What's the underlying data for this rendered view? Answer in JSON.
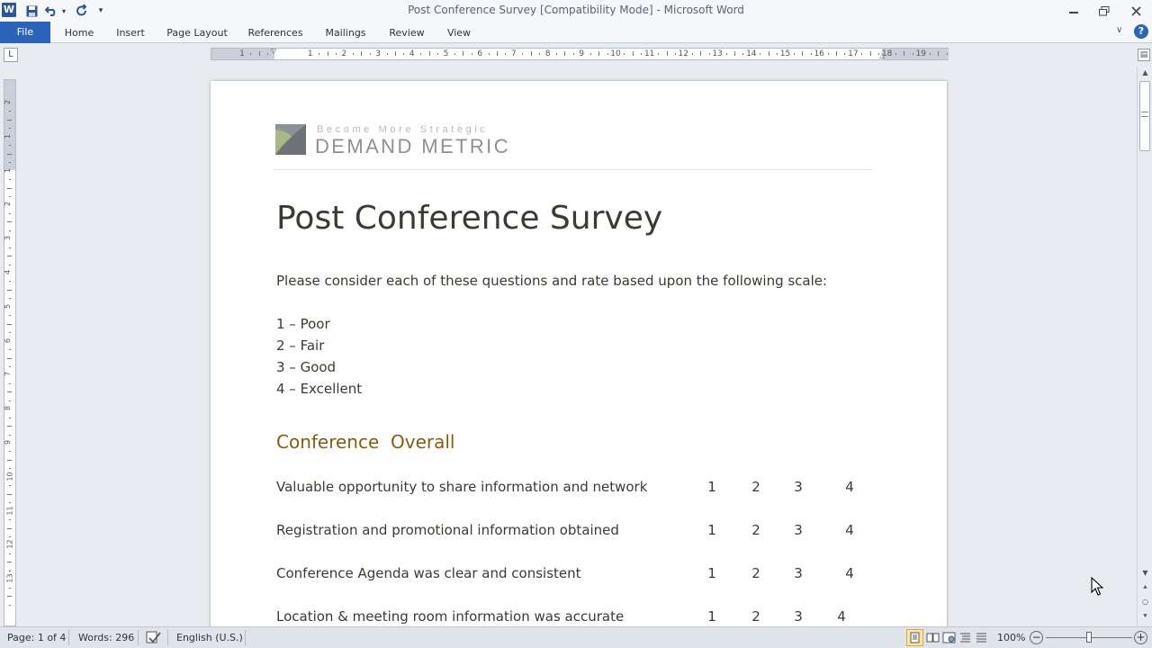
{
  "window": {
    "title": "Post Conference Survey [Compatibility Mode]  -  Microsoft Word",
    "app_icon": "word-icon"
  },
  "quick_access": [
    "save-icon",
    "undo-icon",
    "redo-icon",
    "customize-icon"
  ],
  "ribbon": {
    "tabs": [
      "File",
      "Home",
      "Insert",
      "Page Layout",
      "References",
      "Mailings",
      "Review",
      "View"
    ]
  },
  "ruler": {
    "labels": [
      "1",
      "1",
      "2",
      "3",
      "4",
      "5",
      "6",
      "7",
      "8",
      "9",
      "10",
      "11",
      "12",
      "13",
      "14",
      "15",
      "16",
      "17",
      "18",
      "19"
    ],
    "vlabels": [
      "2",
      "1",
      "1",
      "2",
      "3",
      "4",
      "5",
      "6",
      "7",
      "8",
      "9",
      "10",
      "11",
      "12",
      "13"
    ],
    "tab_selector": "L"
  },
  "document": {
    "logo": {
      "tagline": "Become More Strategic",
      "brand": "DEMAND METRIC"
    },
    "title": "Post Conference Survey",
    "intro": "Please consider each of these questions and rate based upon the following scale:",
    "scale": [
      "1 – Poor",
      "2 – Fair",
      "3 – Good",
      "4 – Excellent"
    ],
    "section_heading": "Conference  Overall",
    "questions": [
      {
        "text": "Valuable opportunity to share information and network",
        "ratings": [
          "1",
          "2",
          "3",
          "4"
        ]
      },
      {
        "text": "Registration and promotional information obtained",
        "ratings": [
          "1",
          "2",
          "3",
          "4"
        ]
      },
      {
        "text": "Conference Agenda was clear and consistent",
        "ratings": [
          "1",
          "2",
          "3",
          "4"
        ]
      },
      {
        "text": "Location & meeting room information was accurate",
        "ratings": [
          "1",
          "2",
          "3",
          "4"
        ]
      }
    ]
  },
  "status_bar": {
    "page": "Page: 1 of 4",
    "words": "Words: 296",
    "language": "English (U.S.)",
    "zoom": "100%",
    "zoom_level": 100
  },
  "colors": {
    "accent": "#2b64b8",
    "heading": "#3b3b32",
    "section": "#8a5a10",
    "logo_gray": "#8c9196",
    "logo_green": "#a7b987"
  }
}
